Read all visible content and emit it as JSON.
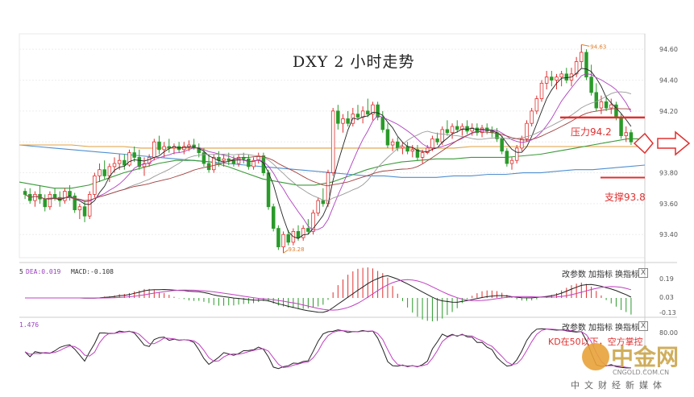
{
  "chart_data": {
    "type": "candlestick",
    "title": "DXY 2 小时走势",
    "ylim": [
      93.25,
      94.7
    ],
    "yticks": [
      "94.60",
      "94.40",
      "94.20",
      "94.00",
      "93.80",
      "93.60",
      "93.40"
    ],
    "annotations": {
      "high_label": "94.63",
      "low_label": "93.28",
      "resistance_label": "压力94.2",
      "support_label": "支撑93.8",
      "resistance_level": 94.2,
      "support_level": 93.8
    },
    "candles": [
      [
        93.68,
        93.7,
        93.63,
        93.66
      ],
      [
        93.66,
        93.7,
        93.6,
        93.62
      ],
      [
        93.62,
        93.68,
        93.58,
        93.66
      ],
      [
        93.66,
        93.72,
        93.6,
        93.63
      ],
      [
        93.63,
        93.66,
        93.55,
        93.58
      ],
      [
        93.58,
        93.68,
        93.56,
        93.66
      ],
      [
        93.66,
        93.7,
        93.62,
        93.64
      ],
      [
        93.64,
        93.68,
        93.58,
        93.62
      ],
      [
        93.62,
        93.7,
        93.6,
        93.68
      ],
      [
        93.68,
        93.72,
        93.62,
        93.65
      ],
      [
        93.65,
        93.67,
        93.54,
        93.56
      ],
      [
        93.56,
        93.6,
        93.5,
        93.58
      ],
      [
        93.58,
        93.62,
        93.48,
        93.52
      ],
      [
        93.52,
        93.68,
        93.5,
        93.66
      ],
      [
        93.66,
        93.8,
        93.64,
        93.78
      ],
      [
        93.78,
        93.86,
        93.74,
        93.82
      ],
      [
        93.82,
        93.88,
        93.76,
        93.78
      ],
      [
        93.78,
        93.86,
        93.74,
        93.84
      ],
      [
        93.84,
        93.9,
        93.8,
        93.86
      ],
      [
        93.86,
        93.92,
        93.82,
        93.88
      ],
      [
        93.88,
        93.92,
        93.82,
        93.85
      ],
      [
        93.85,
        93.95,
        93.84,
        93.93
      ],
      [
        93.93,
        93.97,
        93.87,
        93.9
      ],
      [
        93.9,
        93.95,
        93.82,
        93.84
      ],
      [
        93.84,
        93.9,
        93.78,
        93.86
      ],
      [
        93.86,
        93.92,
        93.84,
        93.9
      ],
      [
        93.9,
        94.02,
        93.88,
        94.0
      ],
      [
        94.0,
        94.04,
        93.92,
        93.95
      ],
      [
        93.95,
        94.0,
        93.9,
        93.97
      ],
      [
        93.97,
        94.02,
        93.93,
        93.96
      ],
      [
        93.96,
        93.99,
        93.92,
        93.97
      ],
      [
        93.97,
        94.0,
        93.93,
        93.95
      ],
      [
        93.95,
        94.0,
        93.92,
        93.97
      ],
      [
        93.97,
        94.01,
        93.94,
        93.98
      ],
      [
        93.98,
        94.02,
        93.95,
        93.96
      ],
      [
        93.96,
        93.99,
        93.9,
        93.93
      ],
      [
        93.93,
        93.96,
        93.84,
        93.86
      ],
      [
        93.86,
        93.92,
        93.8,
        93.82
      ],
      [
        93.82,
        93.92,
        93.8,
        93.9
      ],
      [
        93.9,
        93.94,
        93.84,
        93.88
      ],
      [
        93.88,
        93.92,
        93.84,
        93.89
      ],
      [
        93.89,
        93.93,
        93.85,
        93.88
      ],
      [
        93.88,
        93.91,
        93.84,
        93.86
      ],
      [
        93.86,
        93.92,
        93.84,
        93.9
      ],
      [
        93.9,
        93.93,
        93.86,
        93.89
      ],
      [
        93.89,
        93.92,
        93.82,
        93.84
      ],
      [
        93.84,
        93.9,
        93.82,
        93.88
      ],
      [
        93.88,
        93.93,
        93.86,
        93.91
      ],
      [
        93.91,
        93.93,
        93.78,
        93.8
      ],
      [
        93.8,
        93.82,
        93.56,
        93.58
      ],
      [
        93.58,
        93.6,
        93.42,
        93.44
      ],
      [
        93.44,
        93.46,
        93.3,
        93.32
      ],
      [
        93.32,
        93.42,
        93.28,
        93.4
      ],
      [
        93.4,
        93.43,
        93.33,
        93.35
      ],
      [
        93.35,
        93.44,
        93.33,
        93.42
      ],
      [
        93.42,
        93.46,
        93.36,
        93.38
      ],
      [
        93.38,
        93.46,
        93.36,
        93.44
      ],
      [
        93.44,
        93.5,
        93.4,
        93.42
      ],
      [
        93.42,
        93.56,
        93.4,
        93.54
      ],
      [
        93.54,
        93.64,
        93.52,
        93.62
      ],
      [
        93.62,
        93.7,
        93.58,
        93.6
      ],
      [
        93.6,
        93.82,
        93.58,
        93.8
      ],
      [
        93.8,
        94.22,
        93.78,
        94.2
      ],
      [
        94.2,
        94.24,
        94.08,
        94.12
      ],
      [
        94.12,
        94.18,
        94.06,
        94.15
      ],
      [
        94.15,
        94.2,
        94.1,
        94.12
      ],
      [
        94.12,
        94.22,
        94.1,
        94.18
      ],
      [
        94.18,
        94.24,
        94.14,
        94.16
      ],
      [
        94.16,
        94.23,
        94.12,
        94.2
      ],
      [
        94.2,
        94.28,
        94.16,
        94.18
      ],
      [
        94.18,
        94.26,
        94.14,
        94.24
      ],
      [
        94.24,
        94.26,
        94.14,
        94.16
      ],
      [
        94.16,
        94.2,
        94.06,
        94.08
      ],
      [
        94.08,
        94.12,
        93.96,
        93.98
      ],
      [
        93.98,
        94.02,
        93.94,
        94.0
      ],
      [
        94.0,
        94.03,
        93.94,
        93.96
      ],
      [
        93.96,
        94.0,
        93.92,
        93.97
      ],
      [
        93.97,
        94.0,
        93.92,
        93.94
      ],
      [
        93.94,
        93.98,
        93.9,
        93.95
      ],
      [
        93.95,
        93.98,
        93.88,
        93.9
      ],
      [
        93.9,
        93.95,
        93.86,
        93.93
      ],
      [
        93.93,
        93.98,
        93.92,
        93.96
      ],
      [
        93.96,
        94.04,
        93.94,
        94.02
      ],
      [
        94.02,
        94.06,
        93.98,
        94.0
      ],
      [
        94.0,
        94.1,
        93.98,
        94.08
      ],
      [
        94.08,
        94.14,
        94.04,
        94.06
      ],
      [
        94.06,
        94.12,
        94.02,
        94.1
      ],
      [
        94.1,
        94.14,
        94.06,
        94.08
      ],
      [
        94.08,
        94.12,
        94.04,
        94.1
      ],
      [
        94.1,
        94.14,
        94.05,
        94.07
      ],
      [
        94.07,
        94.12,
        94.04,
        94.09
      ],
      [
        94.09,
        94.12,
        94.04,
        94.06
      ],
      [
        94.06,
        94.11,
        94.03,
        94.09
      ],
      [
        94.09,
        94.12,
        94.05,
        94.07
      ],
      [
        94.07,
        94.1,
        94.03,
        94.06
      ],
      [
        94.06,
        94.09,
        94.0,
        94.02
      ],
      [
        94.02,
        94.04,
        93.92,
        93.94
      ],
      [
        93.94,
        93.96,
        93.84,
        93.86
      ],
      [
        93.86,
        93.9,
        93.82,
        93.88
      ],
      [
        93.88,
        93.98,
        93.86,
        93.96
      ],
      [
        93.96,
        94.04,
        93.94,
        94.02
      ],
      [
        94.02,
        94.14,
        94.0,
        94.12
      ],
      [
        94.12,
        94.22,
        94.1,
        94.2
      ],
      [
        94.2,
        94.3,
        94.18,
        94.28
      ],
      [
        94.28,
        94.4,
        94.26,
        94.38
      ],
      [
        94.38,
        94.46,
        94.34,
        94.42
      ],
      [
        94.42,
        94.46,
        94.36,
        94.4
      ],
      [
        94.4,
        94.44,
        94.34,
        94.42
      ],
      [
        94.42,
        94.46,
        94.36,
        94.44
      ],
      [
        94.44,
        94.48,
        94.38,
        94.4
      ],
      [
        94.4,
        94.48,
        94.36,
        94.44
      ],
      [
        94.44,
        94.55,
        94.42,
        94.52
      ],
      [
        94.52,
        94.63,
        94.48,
        94.58
      ],
      [
        94.58,
        94.6,
        94.4,
        94.42
      ],
      [
        94.42,
        94.5,
        94.3,
        94.32
      ],
      [
        94.32,
        94.38,
        94.2,
        94.22
      ],
      [
        94.22,
        94.3,
        94.18,
        94.26
      ],
      [
        94.26,
        94.3,
        94.2,
        94.22
      ],
      [
        94.22,
        94.28,
        94.18,
        94.24
      ],
      [
        94.24,
        94.26,
        94.14,
        94.16
      ],
      [
        94.16,
        94.18,
        94.02,
        94.04
      ],
      [
        94.04,
        94.1,
        94.0,
        94.06
      ],
      [
        94.06,
        94.08,
        93.98,
        94.0
      ]
    ],
    "ma_series": [
      {
        "color": "#4f8fd0",
        "values": [
          93.98,
          93.97,
          93.96,
          93.95,
          93.94,
          93.93,
          93.92,
          93.91,
          93.9,
          93.89,
          93.88,
          93.87,
          93.86,
          93.85,
          93.84,
          93.83,
          93.82,
          93.81,
          93.8,
          93.79,
          93.78,
          93.78,
          93.77,
          93.77,
          93.77,
          93.78,
          93.78,
          93.79,
          93.79,
          93.8,
          93.8,
          93.81,
          93.82,
          93.82,
          93.83,
          93.84,
          93.85
        ]
      },
      {
        "color": "#e0a040",
        "values": [
          93.98,
          93.98,
          93.98,
          93.98,
          93.97,
          93.97,
          93.97,
          93.96,
          93.96,
          93.96,
          93.96,
          93.96,
          93.96,
          93.96,
          93.96,
          93.96,
          93.96,
          93.96,
          93.96,
          93.96,
          93.96,
          93.96,
          93.96,
          93.96,
          93.96,
          93.96,
          93.97,
          93.97,
          93.97,
          93.97,
          93.97,
          93.97,
          93.97,
          93.97,
          93.97,
          93.97,
          93.97
        ]
      },
      {
        "color": "#3a9a3a",
        "values": [
          93.74,
          93.72,
          93.7,
          93.7,
          93.72,
          93.76,
          93.8,
          93.83,
          93.86,
          93.88,
          93.88,
          93.87,
          93.84,
          93.8,
          93.76,
          93.74,
          93.72,
          93.72,
          93.74,
          93.78,
          93.82,
          93.85,
          93.87,
          93.88,
          93.89,
          93.89,
          93.9,
          93.9,
          93.9,
          93.91,
          93.92,
          93.94,
          93.96,
          93.98,
          94.0,
          94.02,
          94.02
        ]
      }
    ],
    "macd": {
      "labels": [
        "5",
        "DEA:0.019",
        "MACD:-0.108"
      ],
      "yticks": [
        "0.19",
        "0.03",
        "-0.13"
      ]
    },
    "kd": {
      "labels": [
        "1.476"
      ],
      "yticks": [
        "80.00"
      ],
      "note": "KD在50以下，空方掌控"
    }
  },
  "toolbar": {
    "params": "改参数",
    "add": "加指标",
    "switch": "换指标",
    "close": "X"
  },
  "watermark": {
    "brand": "中金网",
    "url": "CNGOLD.COM.CN",
    "tagline": "中文财经新媒体"
  },
  "colors": {
    "up": "#e03030",
    "down": "#2a9a2a",
    "accent": "#e03030"
  }
}
